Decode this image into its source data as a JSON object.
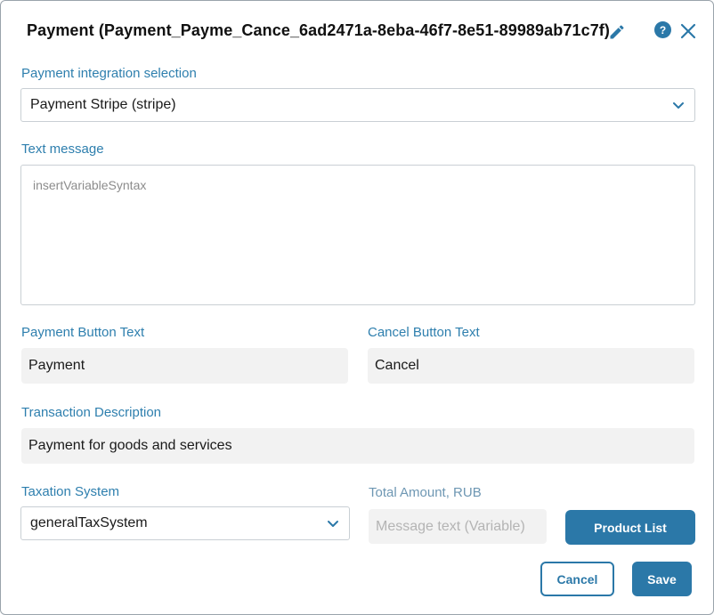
{
  "dialog": {
    "title": "Payment (Payment_Payme_Cance_6ad2471a-8eba-46f7-8e51-89989ab71c7f)",
    "help_glyph": "?"
  },
  "integration": {
    "label": "Payment integration selection",
    "selected": "Payment Stripe (stripe)"
  },
  "text_message": {
    "label": "Text message",
    "placeholder": "insertVariableSyntax"
  },
  "payment_button_text": {
    "label": "Payment Button Text",
    "value": "Payment"
  },
  "cancel_button_text": {
    "label": "Cancel Button Text",
    "value": "Cancel"
  },
  "transaction_description": {
    "label": "Transaction Description",
    "value": "Payment for goods and services"
  },
  "taxation": {
    "label": "Taxation System",
    "selected": "generalTaxSystem"
  },
  "total_amount": {
    "label": "Total Amount, RUB",
    "placeholder": "Message text (Variable)"
  },
  "buttons": {
    "product_list": "Product List",
    "cancel": "Cancel",
    "save": "Save"
  },
  "colors": {
    "accent": "#2b78a8",
    "label": "#2e7fae",
    "input_bg": "#f2f2f2"
  }
}
